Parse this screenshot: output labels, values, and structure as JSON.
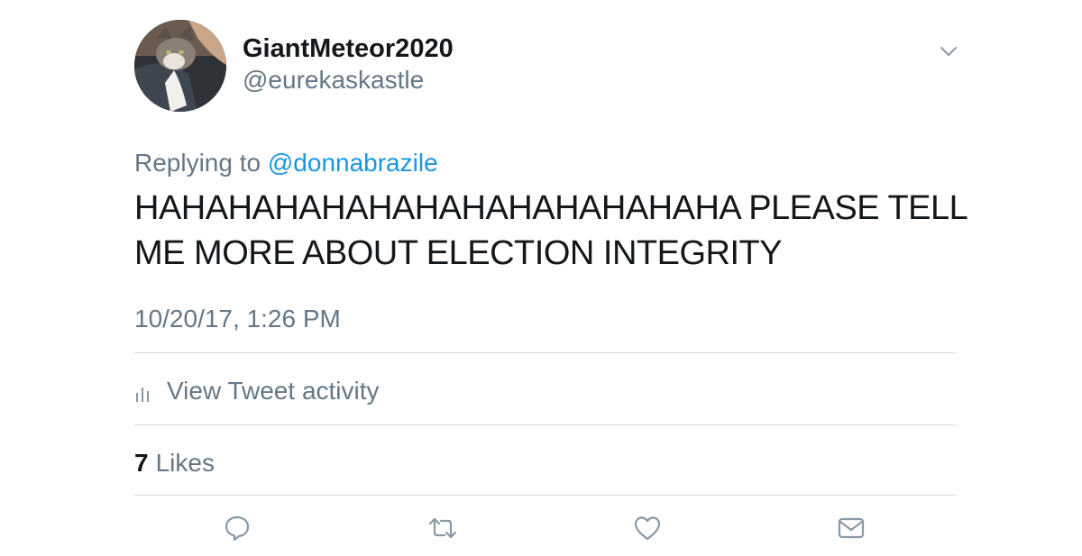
{
  "user": {
    "display_name": "GiantMeteor2020",
    "handle": "@eurekaskastle",
    "avatar": "cat-avatar"
  },
  "reply": {
    "prefix": "Replying to",
    "mention": "@donnabrazile"
  },
  "tweet": {
    "text": "HAHAHAHAHAHAHAHAHAHAHAHAHA PLEASE TELL ME MORE ABOUT ELECTION INTEGRITY",
    "timestamp": "10/20/17, 1:26 PM"
  },
  "activity": {
    "label": "View Tweet activity",
    "icon": "bar-chart-icon"
  },
  "likes": {
    "count": "7",
    "label": "Likes"
  },
  "actions": [
    {
      "name": "reply",
      "icon": "speech-bubble-icon"
    },
    {
      "name": "retweet",
      "icon": "retweet-icon"
    },
    {
      "name": "like",
      "icon": "heart-icon"
    },
    {
      "name": "direct-message",
      "icon": "envelope-icon"
    }
  ],
  "colors": {
    "text": "#14171a",
    "secondary": "#657786",
    "link": "#1b95e0",
    "divider": "#d8dde2"
  }
}
